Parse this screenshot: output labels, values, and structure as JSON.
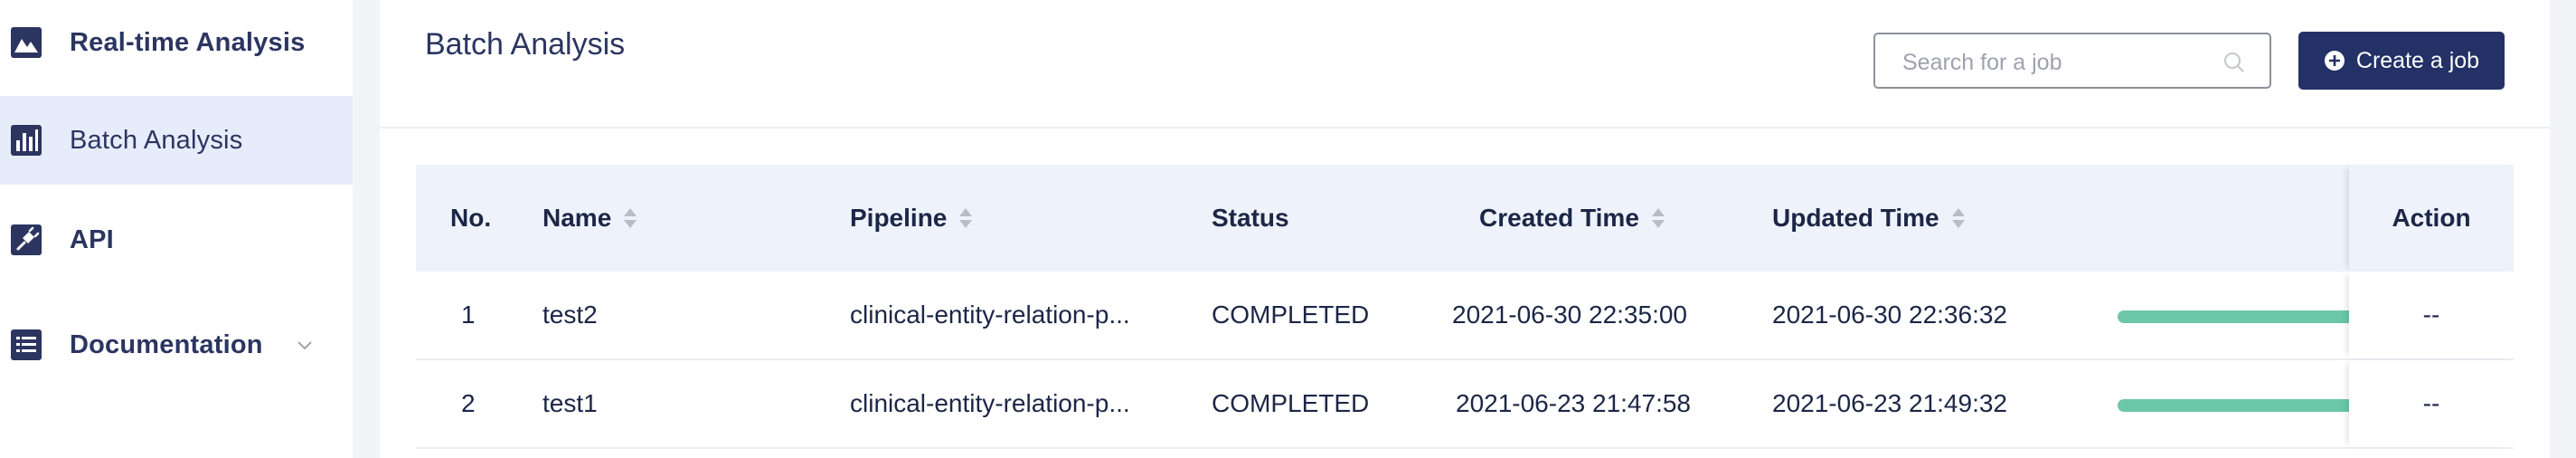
{
  "sidebar": {
    "items": [
      {
        "label": "Real-time Analysis",
        "icon": "image-chart-icon",
        "active": false
      },
      {
        "label": "Batch Analysis",
        "icon": "bar-chart-icon",
        "active": true
      },
      {
        "label": "API",
        "icon": "plug-icon",
        "active": false
      },
      {
        "label": "Documentation",
        "icon": "document-list-icon",
        "active": false,
        "expandable": true
      }
    ]
  },
  "header": {
    "title": "Batch Analysis",
    "search_placeholder": "Search for a job",
    "create_label": "Create a job"
  },
  "table": {
    "columns": {
      "no": "No.",
      "name": "Name",
      "pipeline": "Pipeline",
      "status": "Status",
      "created": "Created Time",
      "updated": "Updated Time",
      "action": "Action"
    },
    "rows": [
      {
        "no": "1",
        "name": "test2",
        "pipeline": "clinical-entity-relation-p...",
        "status": "COMPLETED",
        "created": "2021-06-30 22:35:00",
        "updated": "2021-06-30 22:36:32",
        "progress": 1.0,
        "action": "--"
      },
      {
        "no": "2",
        "name": "test1",
        "pipeline": "clinical-entity-relation-p...",
        "status": "COMPLETED",
        "created": "2021-06-23 21:47:58",
        "updated": "2021-06-23 21:49:32",
        "progress": 1.0,
        "action": "--"
      }
    ]
  },
  "colors": {
    "accent": "#233166",
    "active_nav_bg": "#e6ecfa",
    "progress": "#6cc7a8",
    "header_bg": "#eef2fa"
  }
}
